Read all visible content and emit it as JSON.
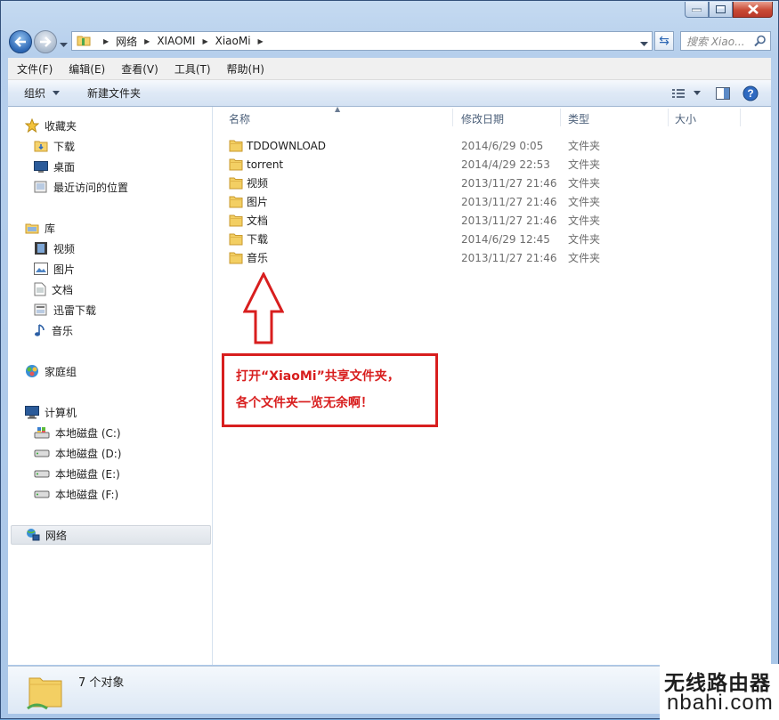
{
  "window": {
    "caption_buttons": [
      "minimize",
      "maximize",
      "close"
    ]
  },
  "address": {
    "segments": [
      "网络",
      "XIAOMI",
      "XiaoMi"
    ],
    "search_placeholder": "搜索 Xiao..."
  },
  "menubar": {
    "items": [
      "文件(F)",
      "编辑(E)",
      "查看(V)",
      "工具(T)",
      "帮助(H)"
    ]
  },
  "toolbar": {
    "organize_label": "组织",
    "new_folder_label": "新建文件夹"
  },
  "nav": {
    "favorites": {
      "header": "收藏夹",
      "items": [
        "下载",
        "桌面",
        "最近访问的位置"
      ]
    },
    "libraries": {
      "header": "库",
      "items": [
        "视频",
        "图片",
        "文档",
        "迅雷下载",
        "音乐"
      ]
    },
    "homegroup": {
      "header": "家庭组"
    },
    "computer": {
      "header": "计算机",
      "items": [
        "本地磁盘 (C:)",
        "本地磁盘 (D:)",
        "本地磁盘 (E:)",
        "本地磁盘 (F:)"
      ]
    },
    "network": {
      "header": "网络"
    }
  },
  "columns": [
    "名称",
    "修改日期",
    "类型",
    "大小"
  ],
  "files": [
    {
      "name": "TDDOWNLOAD",
      "date": "2014/6/29 0:05",
      "type": "文件夹"
    },
    {
      "name": "torrent",
      "date": "2014/4/29 22:53",
      "type": "文件夹"
    },
    {
      "name": "视频",
      "date": "2013/11/27 21:46",
      "type": "文件夹"
    },
    {
      "name": "图片",
      "date": "2013/11/27 21:46",
      "type": "文件夹"
    },
    {
      "name": "文档",
      "date": "2013/11/27 21:46",
      "type": "文件夹"
    },
    {
      "name": "下载",
      "date": "2014/6/29 12:45",
      "type": "文件夹"
    },
    {
      "name": "音乐",
      "date": "2013/11/27 21:46",
      "type": "文件夹"
    }
  ],
  "annotation": {
    "line1": "打开“XiaoMi”共享文件夹，",
    "line2": "各个文件夹一览无余啊！",
    "color": "#d81e1e"
  },
  "status": {
    "text": "7 个对象"
  },
  "watermark": {
    "cn": "无线路由器",
    "en": "nbahi.com"
  }
}
